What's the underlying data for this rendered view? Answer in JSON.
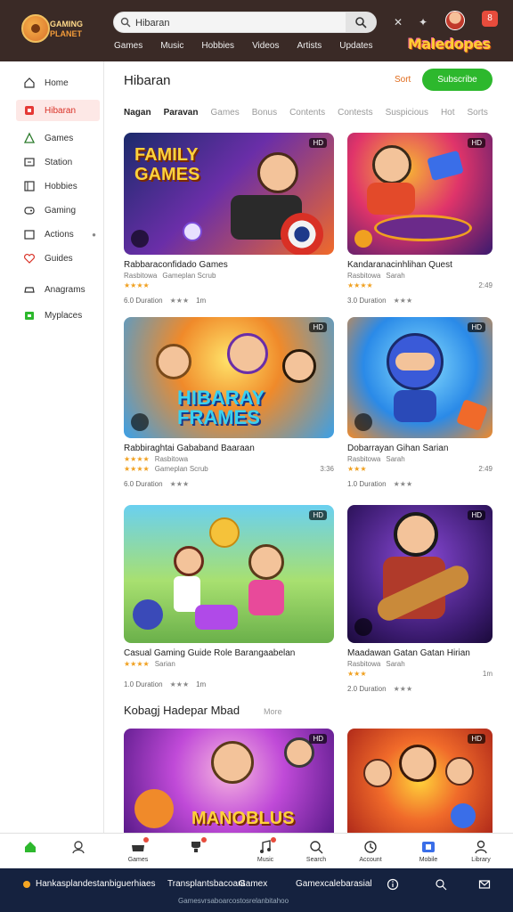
{
  "header": {
    "brand_line1": "GAMING",
    "brand_line2": "PLANET",
    "search_value": "Hibaran",
    "nav": [
      "Games",
      "Music",
      "Hobbies",
      "Videos",
      "Artists",
      "Updates"
    ],
    "wordmark": "Maledopes",
    "notif_count": "8"
  },
  "sidebar": {
    "items": [
      {
        "label": "Home",
        "icon": "home-icon"
      },
      {
        "label": "Hibaran",
        "icon": "flag-icon"
      },
      {
        "label": "Games",
        "icon": "triangle-icon"
      },
      {
        "label": "Station",
        "icon": "tv-icon"
      },
      {
        "label": "Hobbies",
        "icon": "book-icon"
      },
      {
        "label": "Gaming",
        "icon": "controller-icon"
      },
      {
        "label": "Actions",
        "icon": "box-icon"
      },
      {
        "label": "Guides",
        "icon": "heart-icon"
      },
      {
        "label": "Anagrams",
        "icon": "gamepad-icon"
      },
      {
        "label": "Myplaces",
        "icon": "bag-icon"
      }
    ]
  },
  "main": {
    "title": "Hibaran",
    "sort_link": "Sort",
    "cta_label": "Subscribe",
    "tabs": [
      "Nagan",
      "Paravan",
      "Games",
      "Bonus",
      "Contents",
      "Contests",
      "Suspicious",
      "Hot",
      "Sorts"
    ]
  },
  "cards": [
    {
      "thumb_text": "FAMILY GAMES",
      "tag": "HD",
      "title": "Rabbaraconfidado Games",
      "sub": "Rasbitowa",
      "sub2": "Gameplan Scrub",
      "stars": "★★★★",
      "foot1": "6.0 Duration",
      "foot2": "★★★",
      "foot3": "1m"
    },
    {
      "thumb_text": "",
      "tag": "HD",
      "title": "Kandaranacinhlihan Quest",
      "sub": "Rasbitowa",
      "sub2": "Sarah",
      "stars": "★★★★",
      "foot1": "3.0 Duration",
      "foot2": "★★★",
      "foot3": "2:49"
    },
    {
      "thumb_text": "HIBARAY FRAMES",
      "tag": "HD",
      "title": "Rabbiraghtai Gababand Baaraan",
      "sub": "Rasbitowa",
      "sub2": "Gameplan Scrub",
      "stars": "★★★★",
      "foot1": "6.0 Duration",
      "foot2": "★★★",
      "foot3": "3:36"
    },
    {
      "thumb_text": "",
      "tag": "HD",
      "title": "Dobarrayan Gihan Sarian",
      "sub": "Rasbitowa",
      "sub2": "Sarah",
      "stars": "★★★",
      "foot1": "1.0 Duration",
      "foot2": "★★★",
      "foot3": "2:49"
    },
    {
      "thumb_text": "",
      "tag": "HD",
      "title": "Casual Gaming Guide Role Barangaabelan",
      "sub": "Rasbitowa",
      "sub2": "Sarian",
      "stars": "★★★★",
      "foot1": "1.0 Duration",
      "foot2": "★★★",
      "foot3": "1m"
    },
    {
      "thumb_text": "",
      "tag": "HD",
      "title": "Maadawan Gatan Gatan Hirian",
      "sub": "Rasbitowa",
      "sub2": "Sarah",
      "stars": "★★★",
      "foot1": "2.0 Duration",
      "foot2": "★★★",
      "foot3": "1m"
    },
    {
      "thumb_text": "MANOBLUS",
      "tag": "HD",
      "title": "",
      "sub": "",
      "sub2": "",
      "stars": "",
      "foot1": "",
      "foot2": "",
      "foot3": ""
    },
    {
      "thumb_text": "",
      "tag": "HD",
      "title": "",
      "sub": "",
      "sub2": "",
      "stars": "",
      "foot1": "",
      "foot2": "",
      "foot3": ""
    }
  ],
  "section": {
    "title": "Kobagj Hadepar Mbad",
    "link": "More"
  },
  "bottom_nav": [
    {
      "label": "",
      "icon": "home-icon"
    },
    {
      "label": "",
      "icon": "user-icon"
    },
    {
      "label": "Games",
      "icon": "gamepad-icon"
    },
    {
      "label": "",
      "icon": "trophy-icon"
    },
    {
      "label": "Music",
      "icon": "music-icon"
    },
    {
      "label": "Search",
      "icon": "search-icon"
    },
    {
      "label": "Account",
      "icon": "clock-icon"
    },
    {
      "label": "Mobile",
      "icon": "flag-icon"
    },
    {
      "label": "Library",
      "icon": "person-icon"
    }
  ],
  "footer": {
    "left": "Hankasplandestanbiguerhiaes",
    "mid1": "Transplantsbacoant",
    "mid2": "Gamex",
    "mid3": "Gamexcalebarasial",
    "copyright": "Gamesvrsaboarcostosrelanbitahoo"
  },
  "colors": {
    "header_bg": "#3a2a26",
    "accent_green": "#2db82d",
    "accent_red": "#d93025",
    "footer_bg": "#15223f"
  }
}
